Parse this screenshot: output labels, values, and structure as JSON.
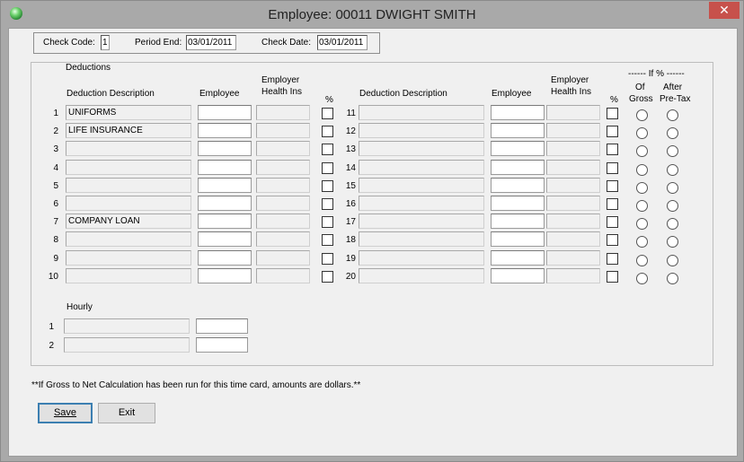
{
  "window": {
    "title": "Employee: 00011 DWIGHT SMITH",
    "close_glyph": "✕"
  },
  "header": {
    "check_code_label": "Check Code:",
    "check_code": "1",
    "period_end_label": "Period End:",
    "period_end": "03/01/2011",
    "check_date_label": "Check Date:",
    "check_date": "03/01/2011"
  },
  "deductions": {
    "group_label": "Deductions",
    "col_description": "Deduction Description",
    "col_employee": "Employee",
    "col_employer_1": "Employer",
    "col_employer_2": "Health Ins",
    "col_percent": "%",
    "if_percent_header": "------ If % ------",
    "of_gross_1": "Of",
    "of_gross_2": "Gross",
    "after_pretax_1": "After",
    "after_pretax_2": "Pre-Tax",
    "left_rows": [
      {
        "num": "1",
        "description": "UNIFORMS"
      },
      {
        "num": "2",
        "description": "LIFE INSURANCE"
      },
      {
        "num": "3",
        "description": ""
      },
      {
        "num": "4",
        "description": ""
      },
      {
        "num": "5",
        "description": ""
      },
      {
        "num": "6",
        "description": ""
      },
      {
        "num": "7",
        "description": "COMPANY LOAN"
      },
      {
        "num": "8",
        "description": ""
      },
      {
        "num": "9",
        "description": ""
      },
      {
        "num": "10",
        "description": ""
      }
    ],
    "right_rows": [
      {
        "num": "11",
        "description": ""
      },
      {
        "num": "12",
        "description": ""
      },
      {
        "num": "13",
        "description": ""
      },
      {
        "num": "14",
        "description": ""
      },
      {
        "num": "15",
        "description": ""
      },
      {
        "num": "16",
        "description": ""
      },
      {
        "num": "17",
        "description": ""
      },
      {
        "num": "18",
        "description": ""
      },
      {
        "num": "19",
        "description": ""
      },
      {
        "num": "20",
        "description": ""
      }
    ]
  },
  "hourly": {
    "label": "Hourly",
    "rows": [
      {
        "num": "1"
      },
      {
        "num": "2"
      }
    ]
  },
  "note": "**If Gross to Net Calculation has been run for this time card, amounts are dollars.**",
  "buttons": {
    "save": "Save",
    "exit": "Exit"
  }
}
